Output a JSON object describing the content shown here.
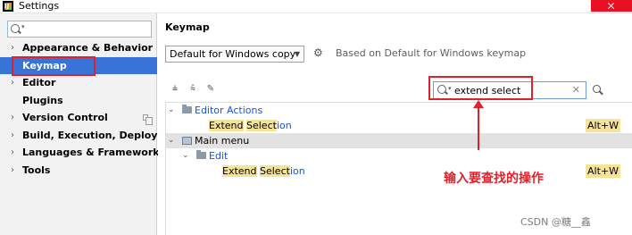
{
  "window": {
    "title": "Settings",
    "app_icon_text": "IJ"
  },
  "sidebar": {
    "search": {
      "value": "",
      "placeholder": ""
    },
    "items": [
      {
        "label": "Appearance & Behavior",
        "expandable": true
      },
      {
        "label": "Keymap",
        "expandable": false,
        "selected": true
      },
      {
        "label": "Editor",
        "expandable": true
      },
      {
        "label": "Plugins",
        "expandable": false
      },
      {
        "label": "Version Control",
        "expandable": true,
        "has_copy_icon": true
      },
      {
        "label": "Build, Execution, Deployment",
        "expandable": true
      },
      {
        "label": "Languages & Frameworks",
        "expandable": true
      },
      {
        "label": "Tools",
        "expandable": true
      }
    ]
  },
  "main": {
    "title": "Keymap",
    "keymap_select": {
      "value": "Default for Windows copy"
    },
    "based_on": "Based on Default for Windows keymap",
    "search": {
      "value": "extend select"
    },
    "tree": {
      "editor_actions": {
        "label": "Editor Actions",
        "action": {
          "prefix": "",
          "match1": "Extend",
          "space": " ",
          "match2": "Select",
          "suffix": "ion",
          "shortcut": "Alt+W"
        }
      },
      "main_menu": {
        "label": "Main menu",
        "edit": {
          "label": "Edit",
          "action": {
            "match1": "Extend",
            "space": " ",
            "match2": "Select",
            "suffix": "ion",
            "shortcut": "Alt+W"
          }
        }
      }
    }
  },
  "annotation": {
    "text": "输入要查找的操作",
    "color": "#e0202a"
  },
  "watermark": "CSDN @糖__鑫",
  "colors": {
    "selection": "#3874d8",
    "highlight_box": "#e0202a",
    "match_highlight": "#f6e39a",
    "link_blue": "#1a56c9"
  }
}
